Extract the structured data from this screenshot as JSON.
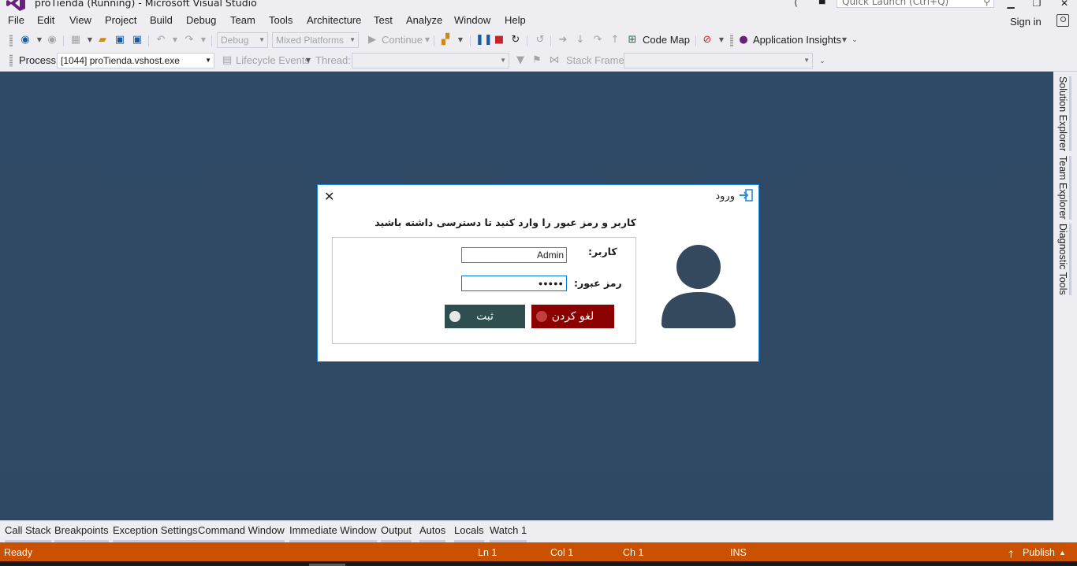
{
  "window": {
    "title": "proTienda (Running) - Microsoft Visual Studio",
    "quick_launch_placeholder": "Quick Launch (Ctrl+Q)"
  },
  "menu": {
    "items": [
      "File",
      "Edit",
      "View",
      "Project",
      "Build",
      "Debug",
      "Team",
      "Tools",
      "Architecture",
      "Test",
      "Analyze",
      "Window",
      "Help"
    ],
    "sign_in": "Sign in"
  },
  "toolbar": {
    "config": "Debug",
    "platform": "Mixed Platforms",
    "continue": "Continue",
    "code_map": "Code Map",
    "app_insights": "Application Insights"
  },
  "debug_location": {
    "process_label": "Process:",
    "process_value": "[1044] proTienda.vshost.exe",
    "lifecycle": "Lifecycle Events",
    "thread_label": "Thread:",
    "thread_value": "",
    "stack_label": "Stack Frame:",
    "stack_value": ""
  },
  "right_tabs": [
    "Solution Explorer",
    "Team Explorer",
    "Diagnostic Tools"
  ],
  "bottom_tabs": [
    "Call Stack",
    "Breakpoints",
    "Exception Settings",
    "Command Window",
    "Immediate Window",
    "Output",
    "Autos",
    "Locals",
    "Watch 1"
  ],
  "status": {
    "ready": "Ready",
    "ln": "Ln 1",
    "col": "Col 1",
    "ch": "Ch 1",
    "ins": "INS",
    "publish": "Publish"
  },
  "dialog": {
    "title": "ورود",
    "heading": "کاربر و رمز عبور را وارد کنید تا دسترسی داشته باشید",
    "user_label": "کاربر:",
    "user_value": "Admin",
    "password_label": "رمز عبور:",
    "password_value": "●●●●●",
    "submit_label": "ثبت",
    "cancel_label": "لغو کردن"
  },
  "colors": {
    "accent_status": "#ca5100",
    "dialog_border": "#1883d7",
    "submit_bg": "#2f4f4f",
    "cancel_bg": "#8b0000",
    "avatar": "#34495e"
  }
}
